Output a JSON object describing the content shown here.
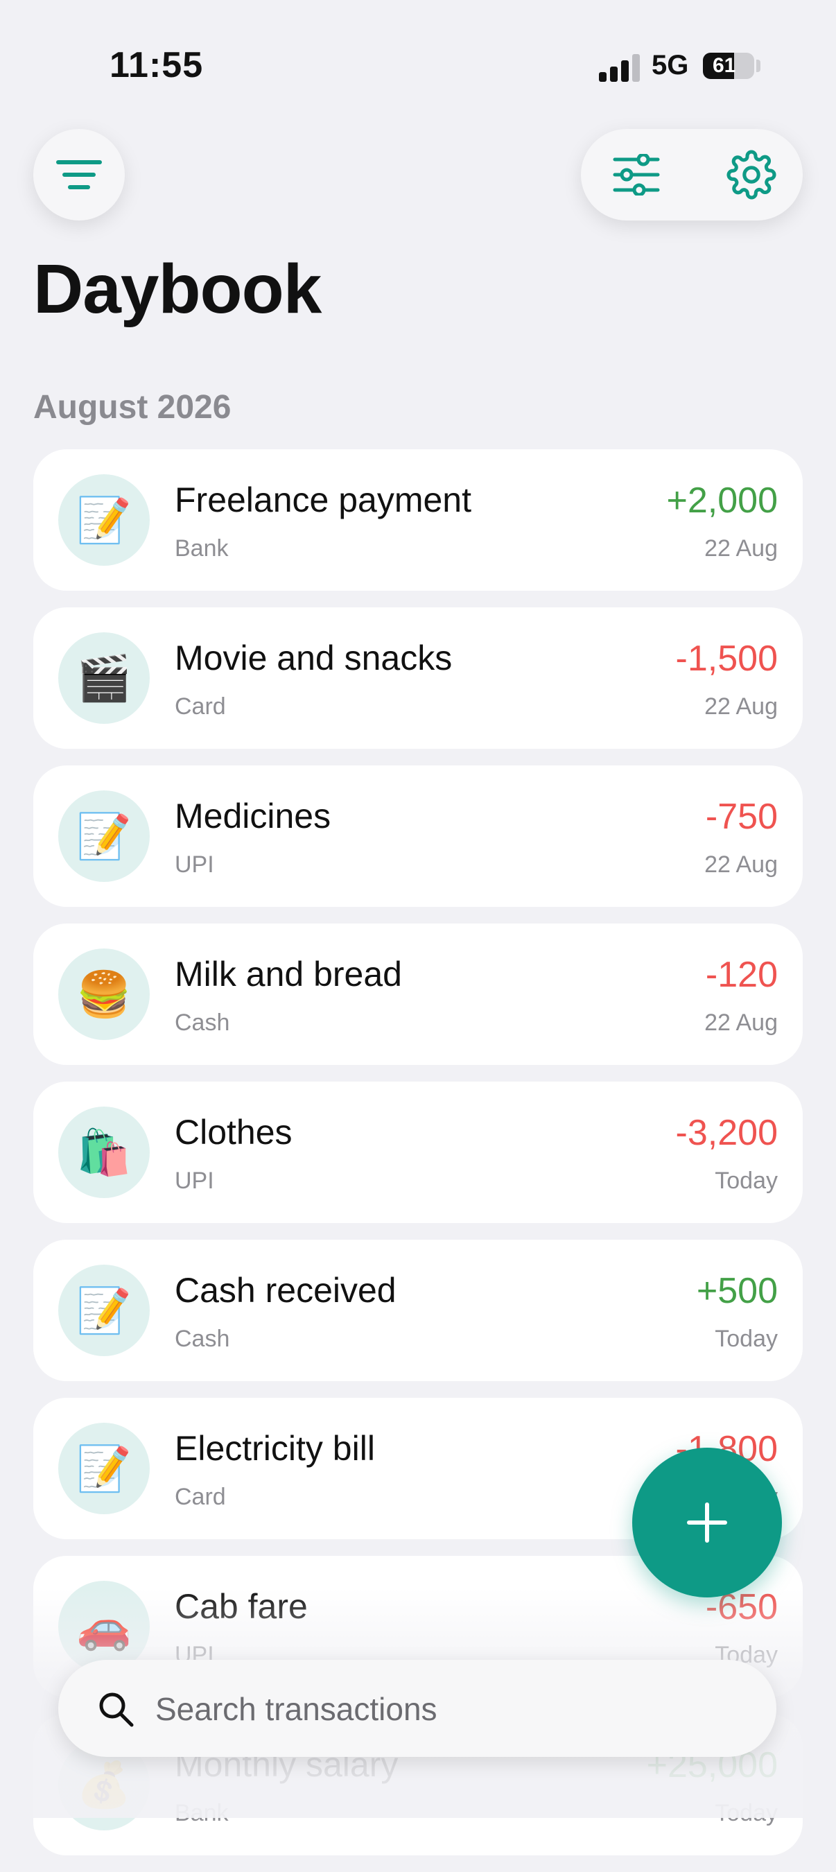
{
  "status_bar": {
    "time": "11:55",
    "network": "5G",
    "battery": "61",
    "battery_level": 0.61
  },
  "header": {
    "title": "Daybook",
    "menu_icon": "hamburger-menu-icon",
    "filter_icon": "sliders-icon",
    "settings_icon": "gear-icon"
  },
  "section": {
    "label": "August 2026"
  },
  "transactions": [
    {
      "emoji": "📝",
      "title": "Freelance payment",
      "method": "Bank",
      "amount": "+2,000",
      "date": "22 Aug",
      "type": "income"
    },
    {
      "emoji": "🎬",
      "title": "Movie and snacks",
      "method": "Card",
      "amount": "-1,500",
      "date": "22 Aug",
      "type": "expense"
    },
    {
      "emoji": "📝",
      "title": "Medicines",
      "method": "UPI",
      "amount": "-750",
      "date": "22 Aug",
      "type": "expense"
    },
    {
      "emoji": "🍔",
      "title": "Milk and bread",
      "method": "Cash",
      "amount": "-120",
      "date": "22 Aug",
      "type": "expense"
    },
    {
      "emoji": "🛍️",
      "title": "Clothes",
      "method": "UPI",
      "amount": "-3,200",
      "date": "Today",
      "type": "expense"
    },
    {
      "emoji": "📝",
      "title": "Cash received",
      "method": "Cash",
      "amount": "+500",
      "date": "Today",
      "type": "income"
    },
    {
      "emoji": "📝",
      "title": "Electricity bill",
      "method": "Card",
      "amount": "-1,800",
      "date": "Today",
      "type": "expense"
    },
    {
      "emoji": "🚗",
      "title": "Cab fare",
      "method": "UPI",
      "amount": "-650",
      "date": "Today",
      "type": "expense"
    },
    {
      "emoji": "💰",
      "title": "Monthly salary",
      "method": "Bank",
      "amount": "+25,000",
      "date": "Today",
      "type": "income"
    }
  ],
  "fab": {
    "icon": "plus-icon"
  },
  "search": {
    "placeholder": "Search transactions",
    "icon": "search-icon"
  },
  "colors": {
    "accent": "#0E9A86",
    "income": "#43A047",
    "expense": "#EF5350",
    "background": "#F1F1F5",
    "icon_bg": "#E0F1EF"
  }
}
